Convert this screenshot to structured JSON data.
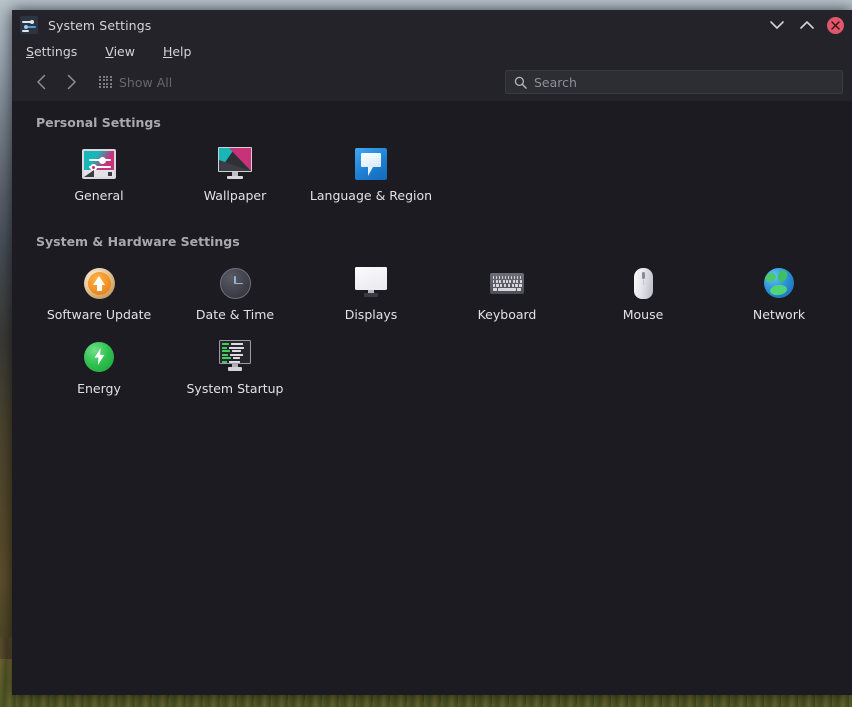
{
  "window": {
    "title": "System Settings",
    "app_icon": "sliders-icon",
    "controls": {
      "minimize": "chevron-down-icon",
      "maximize": "chevron-up-icon",
      "close": "close-icon"
    }
  },
  "menubar": {
    "items": [
      {
        "label": "Settings",
        "accel": "S",
        "rest": "ettings"
      },
      {
        "label": "View",
        "accel": "V",
        "rest": "iew"
      },
      {
        "label": "Help",
        "accel": "H",
        "rest": "elp"
      }
    ]
  },
  "toolbar": {
    "back": "chevron-left-icon",
    "forward": "chevron-right-icon",
    "show_all_label": "Show All",
    "show_all_icon": "grid-dots-icon"
  },
  "search": {
    "placeholder": "Search",
    "value": "",
    "icon": "search-icon"
  },
  "sections": [
    {
      "title": "Personal Settings",
      "items": [
        {
          "label": "General",
          "icon": "display-sliders-icon"
        },
        {
          "label": "Wallpaper",
          "icon": "monitor-wallpaper-icon"
        },
        {
          "label": "Language & Region",
          "icon": "speech-bubble-icon"
        }
      ]
    },
    {
      "title": "System & Hardware Settings",
      "items": [
        {
          "label": "Software Update",
          "icon": "update-arrow-icon"
        },
        {
          "label": "Date & Time",
          "icon": "clock-icon"
        },
        {
          "label": "Displays",
          "icon": "monitor-icon"
        },
        {
          "label": "Keyboard",
          "icon": "keyboard-icon"
        },
        {
          "label": "Mouse",
          "icon": "mouse-icon"
        },
        {
          "label": "Network",
          "icon": "globe-icon"
        },
        {
          "label": "Energy",
          "icon": "power-bolt-icon"
        },
        {
          "label": "System Startup",
          "icon": "boot-terminal-icon"
        }
      ]
    }
  ],
  "colors": {
    "window_chrome": "#232329",
    "content_bg": "#1b1b21",
    "text": "#e2e2e6",
    "muted_text": "#a8a8ae",
    "close_red": "#e0566a",
    "accent_teal": "#19b6b8",
    "accent_magenta": "#c83279",
    "accent_blue": "#2a8fd8",
    "accent_green": "#2fc24e",
    "accent_orange": "#f08f21"
  }
}
